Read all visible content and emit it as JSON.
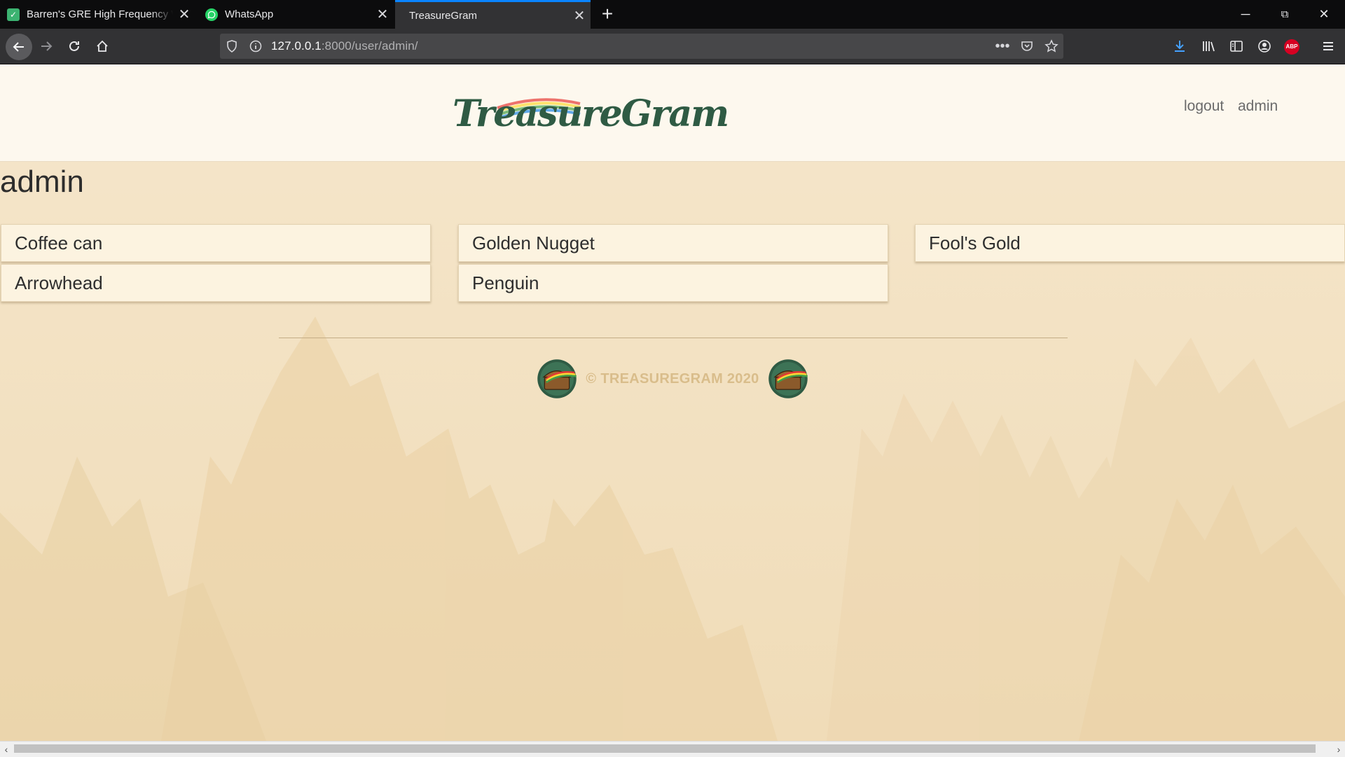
{
  "browser": {
    "tabs": [
      {
        "title": "Barren's GRE High Frequency W",
        "favicon": "check-favicon",
        "favicon_color": "#3cb371",
        "active": false
      },
      {
        "title": "WhatsApp",
        "favicon": "whatsapp-favicon",
        "favicon_color": "#25d366",
        "active": false
      },
      {
        "title": "TreasureGram",
        "favicon": "none",
        "active": true
      }
    ],
    "new_tab_icon": "+",
    "window_controls": {
      "minimize": "─",
      "restore": "⧉",
      "close": "✕"
    },
    "url": {
      "host": "127.0.0.1",
      "rest": ":8000/user/admin/"
    },
    "accent": "#0a84ff",
    "abp_label": "ABP"
  },
  "site": {
    "logo_text": "TreasureGram",
    "nav": {
      "logout": "logout",
      "admin": "admin"
    }
  },
  "profile": {
    "username": "admin",
    "columns": [
      [
        "Coffee can",
        "Arrowhead"
      ],
      [
        "Golden Nugget",
        "Penguin"
      ],
      [
        "Fool's Gold"
      ]
    ]
  },
  "footer": {
    "text": "© TREASUREGRAM 2020"
  },
  "colors": {
    "page_bg": "#f3e1c1",
    "header_bg": "#fdf8ee",
    "card_bg": "#fcf3e0",
    "footer_text": "#d9bd8b",
    "logo_green": "#2f5b44"
  }
}
